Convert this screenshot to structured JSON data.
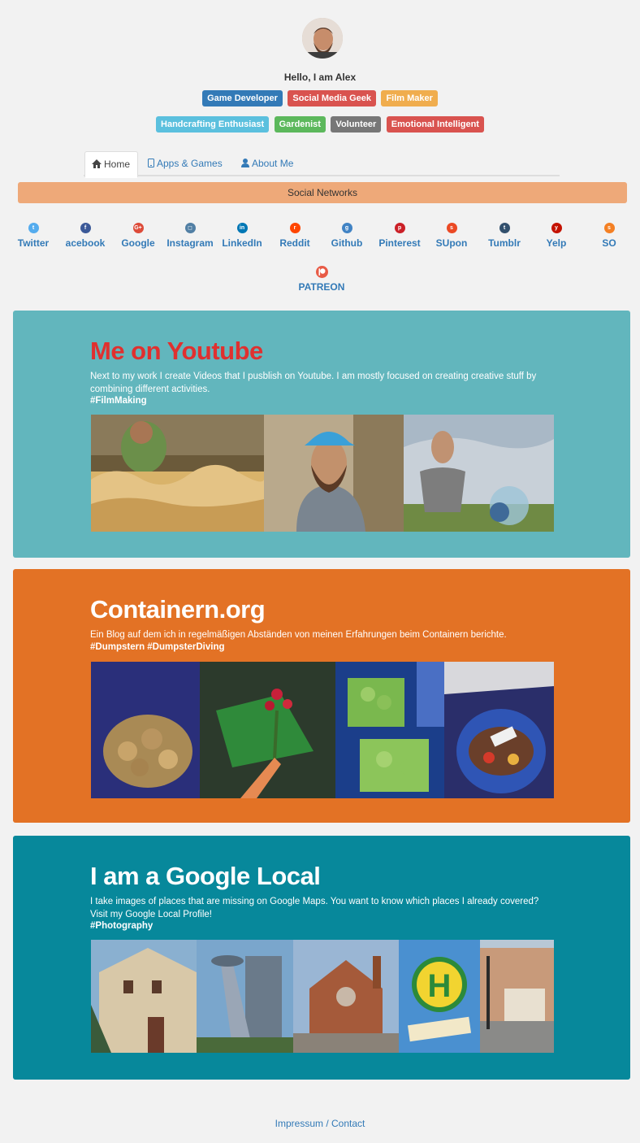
{
  "profile": {
    "greeting": "Hello, I am Alex",
    "tags_row1": [
      {
        "label": "Game Developer",
        "color": "#337ab7"
      },
      {
        "label": "Social Media Geek",
        "color": "#d9534f"
      },
      {
        "label": "Film Maker",
        "color": "#f0ad4e"
      }
    ],
    "tags_row2": [
      {
        "label": "Handcrafting Enthusiast",
        "color": "#5bc0de"
      },
      {
        "label": "Gardenist",
        "color": "#5cb85c"
      },
      {
        "label": "Volunteer",
        "color": "#777777"
      },
      {
        "label": "Emotional Intelligent",
        "color": "#d9534f"
      }
    ]
  },
  "tabs": [
    {
      "label": "Home",
      "icon": "home-icon",
      "active": true
    },
    {
      "label": "Apps & Games",
      "icon": "phone-icon",
      "active": false
    },
    {
      "label": "About Me",
      "icon": "user-icon",
      "active": false
    }
  ],
  "social": {
    "header": "Social Networks",
    "networks": [
      {
        "label": "Twitter",
        "icon": "twitter-icon",
        "color": "#55acee",
        "glyph": "t"
      },
      {
        "label": "acebook",
        "icon": "facebook-icon",
        "color": "#3b5998",
        "glyph": "f"
      },
      {
        "label": "Google",
        "icon": "google-plus-icon",
        "color": "#dd4b39",
        "glyph": "G+"
      },
      {
        "label": "Instagram",
        "icon": "instagram-icon",
        "color": "#517fa4",
        "glyph": "◻"
      },
      {
        "label": "LinkedIn",
        "icon": "linkedin-icon",
        "color": "#0077b5",
        "glyph": "in"
      },
      {
        "label": "Reddit",
        "icon": "reddit-icon",
        "color": "#ff4500",
        "glyph": "r"
      },
      {
        "label": "Github",
        "icon": "github-icon",
        "color": "#4183c4",
        "glyph": "g"
      },
      {
        "label": "Pinterest",
        "icon": "pinterest-icon",
        "color": "#cb2027",
        "glyph": "p"
      },
      {
        "label": "SUpon",
        "icon": "stumbleupon-icon",
        "color": "#eb4924",
        "glyph": "s"
      },
      {
        "label": "Tumblr",
        "icon": "tumblr-icon",
        "color": "#32506d",
        "glyph": "t"
      },
      {
        "label": "Yelp",
        "icon": "yelp-icon",
        "color": "#c41200",
        "glyph": "y"
      },
      {
        "label": "SO",
        "icon": "stackoverflow-icon",
        "color": "#f48024",
        "glyph": "s"
      }
    ],
    "patreon": {
      "label": "PATREON",
      "icon": "patreon-icon",
      "color": "#e85b46"
    }
  },
  "cards": [
    {
      "title": "Me on Youtube",
      "title_color": "#e0302f",
      "bg": "#62b6bd",
      "description": "Next to my work I create Videos that I pusblish on Youtube. I am mostly focused on creating creative stuff by combining different activities.",
      "hashtags": "#FilmMaking"
    },
    {
      "title": "Containern.org",
      "title_color": "#ffffff",
      "bg": "#e37225",
      "description": "Ein Blog auf dem ich in regelmäßigen Abständen von meinen Erfahrungen beim Containern berichte.",
      "hashtags": "#Dumpstern #DumpsterDiving"
    },
    {
      "title": "I am a Google Local",
      "title_color": "#ffffff",
      "bg": "#07889b",
      "description": "I take images of places that are missing on Google Maps. You want to know which places I already covered? Visit my Google Local Profile!",
      "hashtags": "#Photography"
    }
  ],
  "footer": {
    "impressum": "Impressum",
    "separator": " / ",
    "contact": "Contact"
  }
}
